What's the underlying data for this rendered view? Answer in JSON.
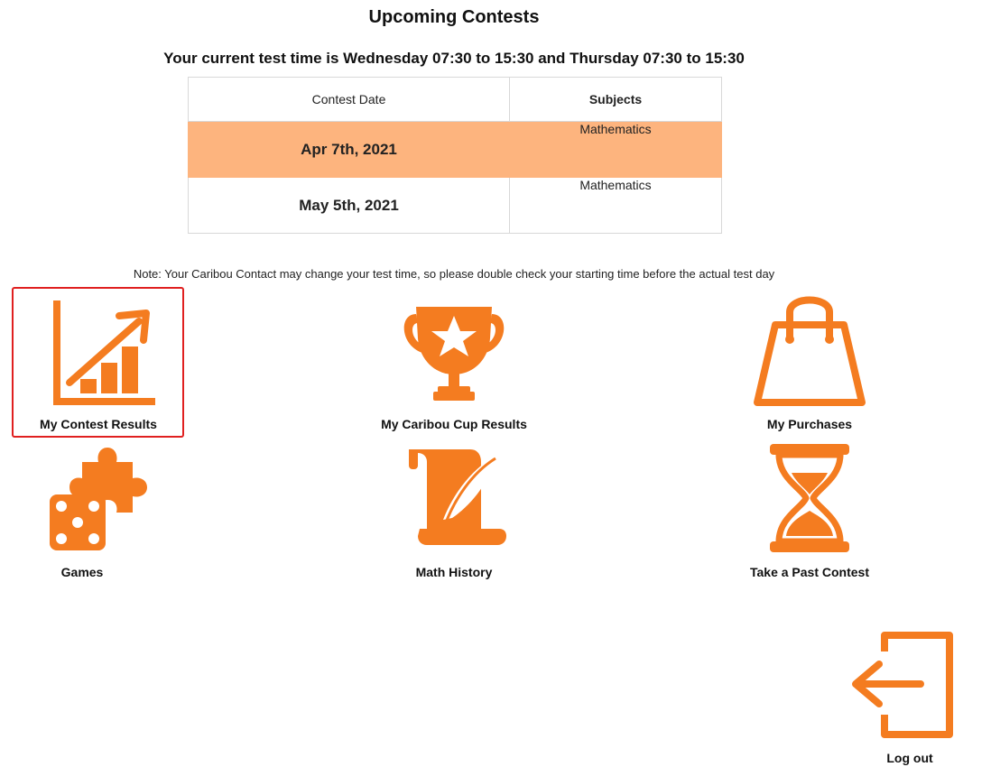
{
  "header": {
    "title": "Upcoming Contests",
    "test_time": "Your current test time is Wednesday 07:30 to 15:30 and Thursday 07:30 to 15:30"
  },
  "table": {
    "columns": [
      "Contest Date",
      "Subjects"
    ],
    "rows": [
      {
        "date": "Apr 7th, 2021",
        "subject": "Mathematics"
      },
      {
        "date": "May 5th, 2021",
        "subject": "Mathematics"
      }
    ]
  },
  "note": "Note: Your Caribou Contact may change your test time, so please double check your starting time before the actual test day",
  "tiles": {
    "contest_results": {
      "label": "My Contest Results",
      "icon": "chart-growth-icon"
    },
    "cup_results": {
      "label": "My Caribou Cup Results",
      "icon": "trophy-icon"
    },
    "purchases": {
      "label": "My Purchases",
      "icon": "shopping-bag-icon"
    },
    "games": {
      "label": "Games",
      "icon": "dice-puzzle-icon"
    },
    "math_history": {
      "label": "Math History",
      "icon": "scroll-quill-icon"
    },
    "past_contest": {
      "label": "Take a Past Contest",
      "icon": "hourglass-icon"
    },
    "logout": {
      "label": "Log out",
      "icon": "logout-icon"
    }
  },
  "colors": {
    "accent": "#f47c20",
    "highlight_row": "#fdb47e",
    "selection_border": "#e02020"
  }
}
